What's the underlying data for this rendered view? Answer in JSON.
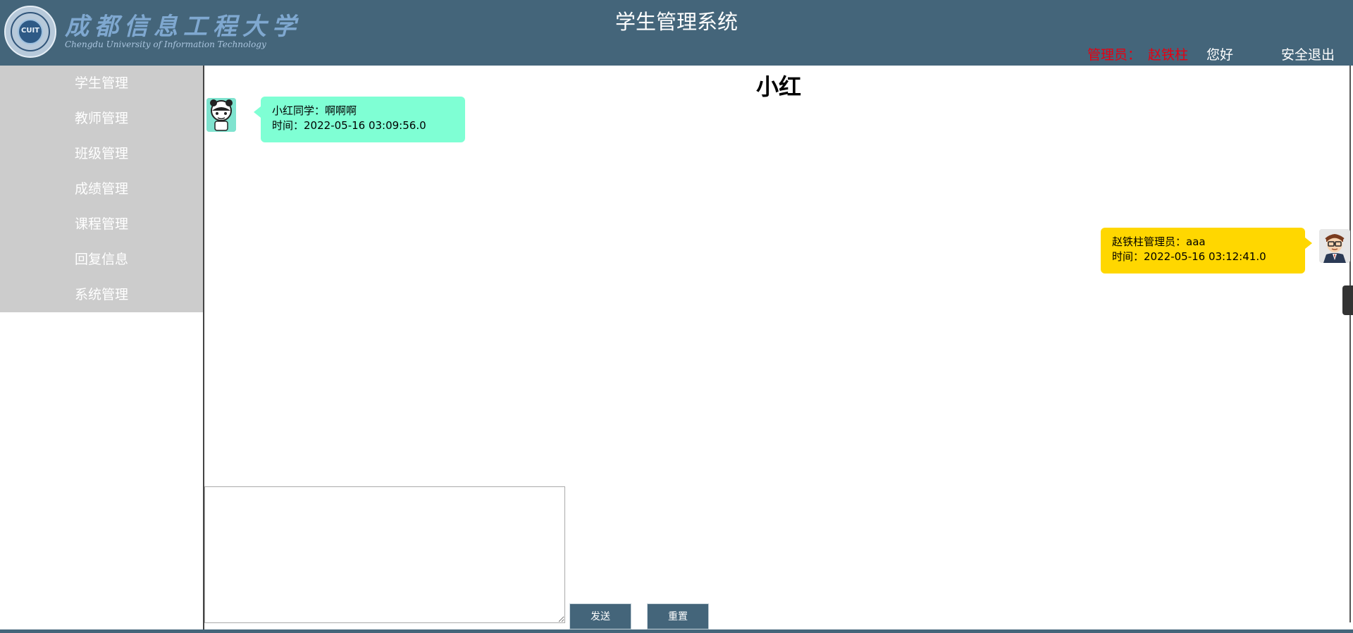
{
  "header": {
    "logo_cn": "成都信息工程大学",
    "logo_en": "Chengdu University of Information Technology",
    "logo_seal_text": "CUIT",
    "system_title": "学生管理系统",
    "admin_label": "管理员：",
    "admin_name": "赵铁柱",
    "greeting": "您好",
    "logout_label": "安全退出"
  },
  "sidebar": {
    "items": [
      {
        "label": "学生管理"
      },
      {
        "label": "教师管理"
      },
      {
        "label": "班级管理"
      },
      {
        "label": "成绩管理"
      },
      {
        "label": "课程管理"
      },
      {
        "label": "回复信息"
      },
      {
        "label": "系统管理"
      }
    ]
  },
  "chat": {
    "title": "小红",
    "messages": [
      {
        "sender": "小红同学：",
        "text": "啊啊啊",
        "time_label": "时间：",
        "time": "2022-05-16 03:09:56.0",
        "side": "left"
      },
      {
        "sender": "赵铁柱管理员：",
        "text": "aaa",
        "time_label": "时间：",
        "time": "2022-05-16 03:12:41.0",
        "side": "right"
      }
    ]
  },
  "composer": {
    "value": "",
    "send_label": "发送",
    "reset_label": "重置"
  },
  "colors": {
    "header_bg": "#44657a",
    "sidebar_bg": "#cccccc",
    "student_bubble": "#7fffd4",
    "admin_bubble": "#ffd700",
    "admin_text": "#e60012"
  },
  "icons": {
    "student_avatar": "student-avatar-icon",
    "admin_avatar": "admin-avatar-icon",
    "logo": "university-seal-icon"
  }
}
